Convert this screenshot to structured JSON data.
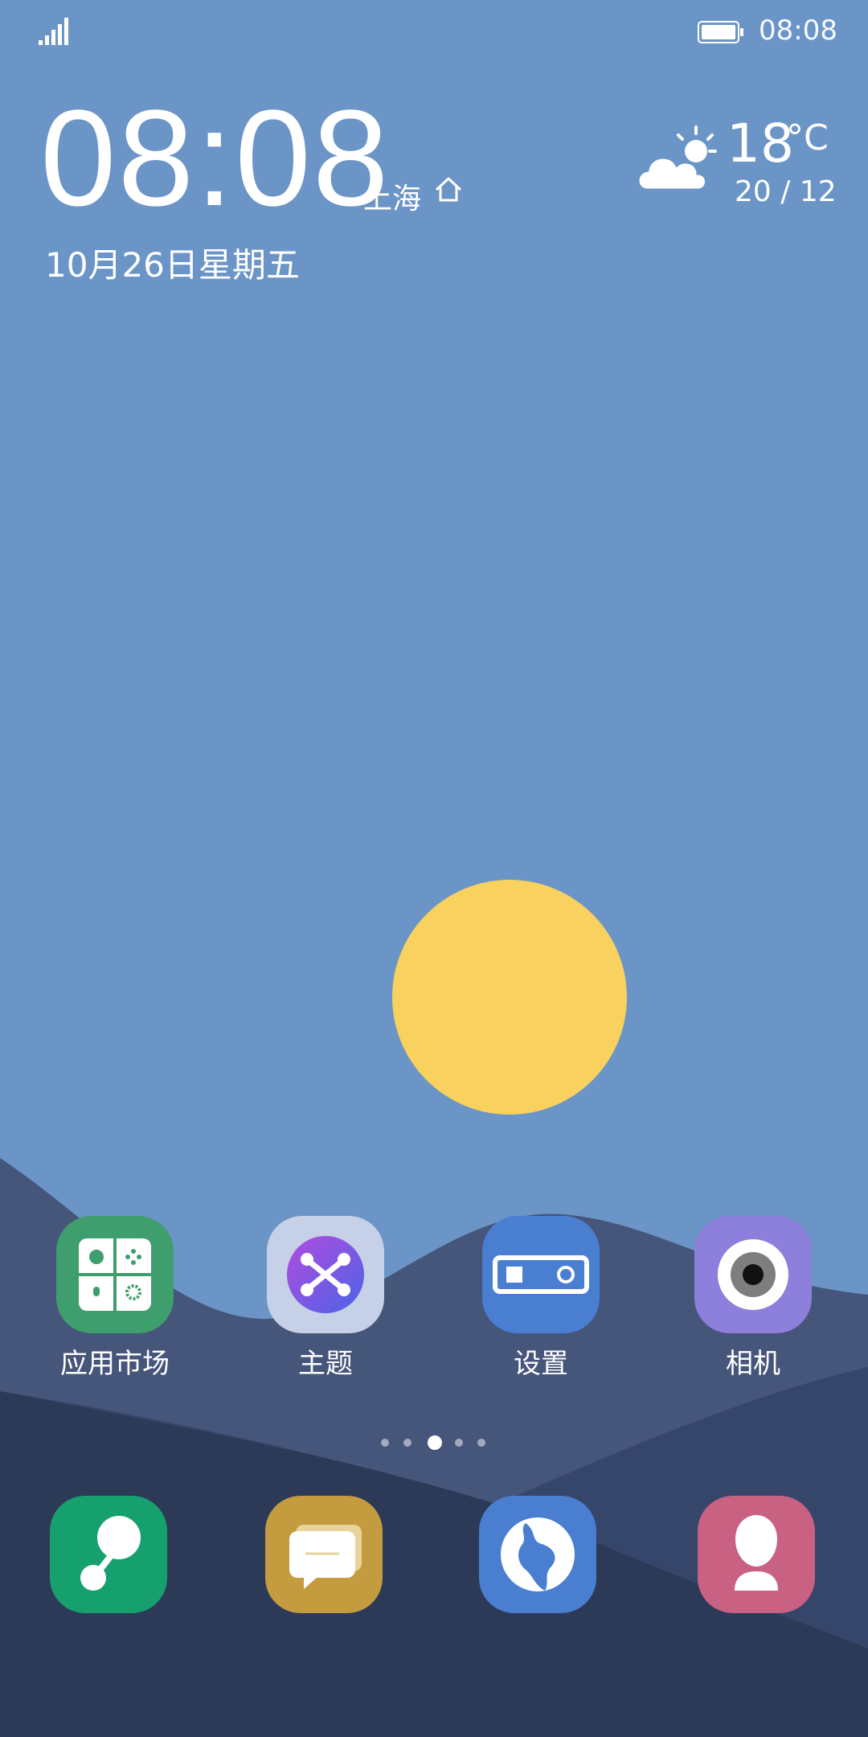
{
  "status_bar": {
    "time": "08:08"
  },
  "clock_widget": {
    "time": "08:08",
    "city": "上海",
    "date": "10月26日星期五"
  },
  "weather": {
    "temperature": "18",
    "unit": "°C",
    "range": "20 / 12"
  },
  "apps": [
    {
      "label": "应用市场",
      "icon": "app-market-icon"
    },
    {
      "label": "主题",
      "icon": "themes-icon"
    },
    {
      "label": "设置",
      "icon": "settings-icon"
    },
    {
      "label": "相机",
      "icon": "camera-icon"
    }
  ],
  "dock": [
    {
      "icon": "phone-icon"
    },
    {
      "icon": "messages-icon"
    },
    {
      "icon": "browser-icon"
    },
    {
      "icon": "contacts-icon"
    }
  ],
  "page_indicator": {
    "pages": 5,
    "current": 3
  },
  "colors": {
    "sky": "#6d95c6",
    "sun": "#f8d15e",
    "hill_mid": "#46557a",
    "hill_dark": "#2c3a58"
  }
}
